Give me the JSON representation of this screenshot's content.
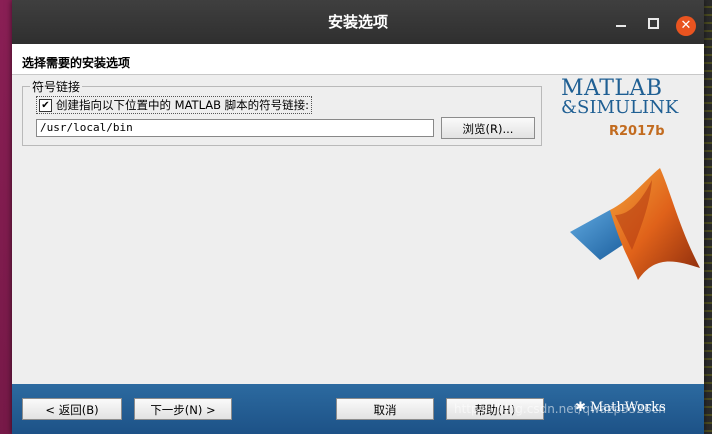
{
  "window": {
    "title": "安装选项",
    "close_glyph": "✕"
  },
  "header": {
    "label": "选择需要的安装选项"
  },
  "symlink_group": {
    "legend": "符号链接",
    "checkbox_checked": true,
    "checkbox_glyph": "✔",
    "checkbox_label": "创建指向以下位置中的 MATLAB 脚本的符号链接:",
    "path_value": "/usr/local/bin",
    "browse_label": "浏览(R)..."
  },
  "branding": {
    "line1": "MATLAB",
    "line2": "&SIMULINK",
    "release": "R2017b",
    "footer_brand": "MathWorks",
    "colors": {
      "blue": "#1f5f93",
      "orange": "#c26b1f"
    }
  },
  "footer": {
    "back_label": "< 返回(B)",
    "next_label": "下一步(N) >",
    "cancel_label": "取消",
    "help_label": "帮助(H)",
    "watermark": "https://blog.csdn.net/qwazp3526cn"
  },
  "colors": {
    "titlebar": "#333333",
    "footer": "#2c6aa0",
    "close_button": "#e95420"
  }
}
